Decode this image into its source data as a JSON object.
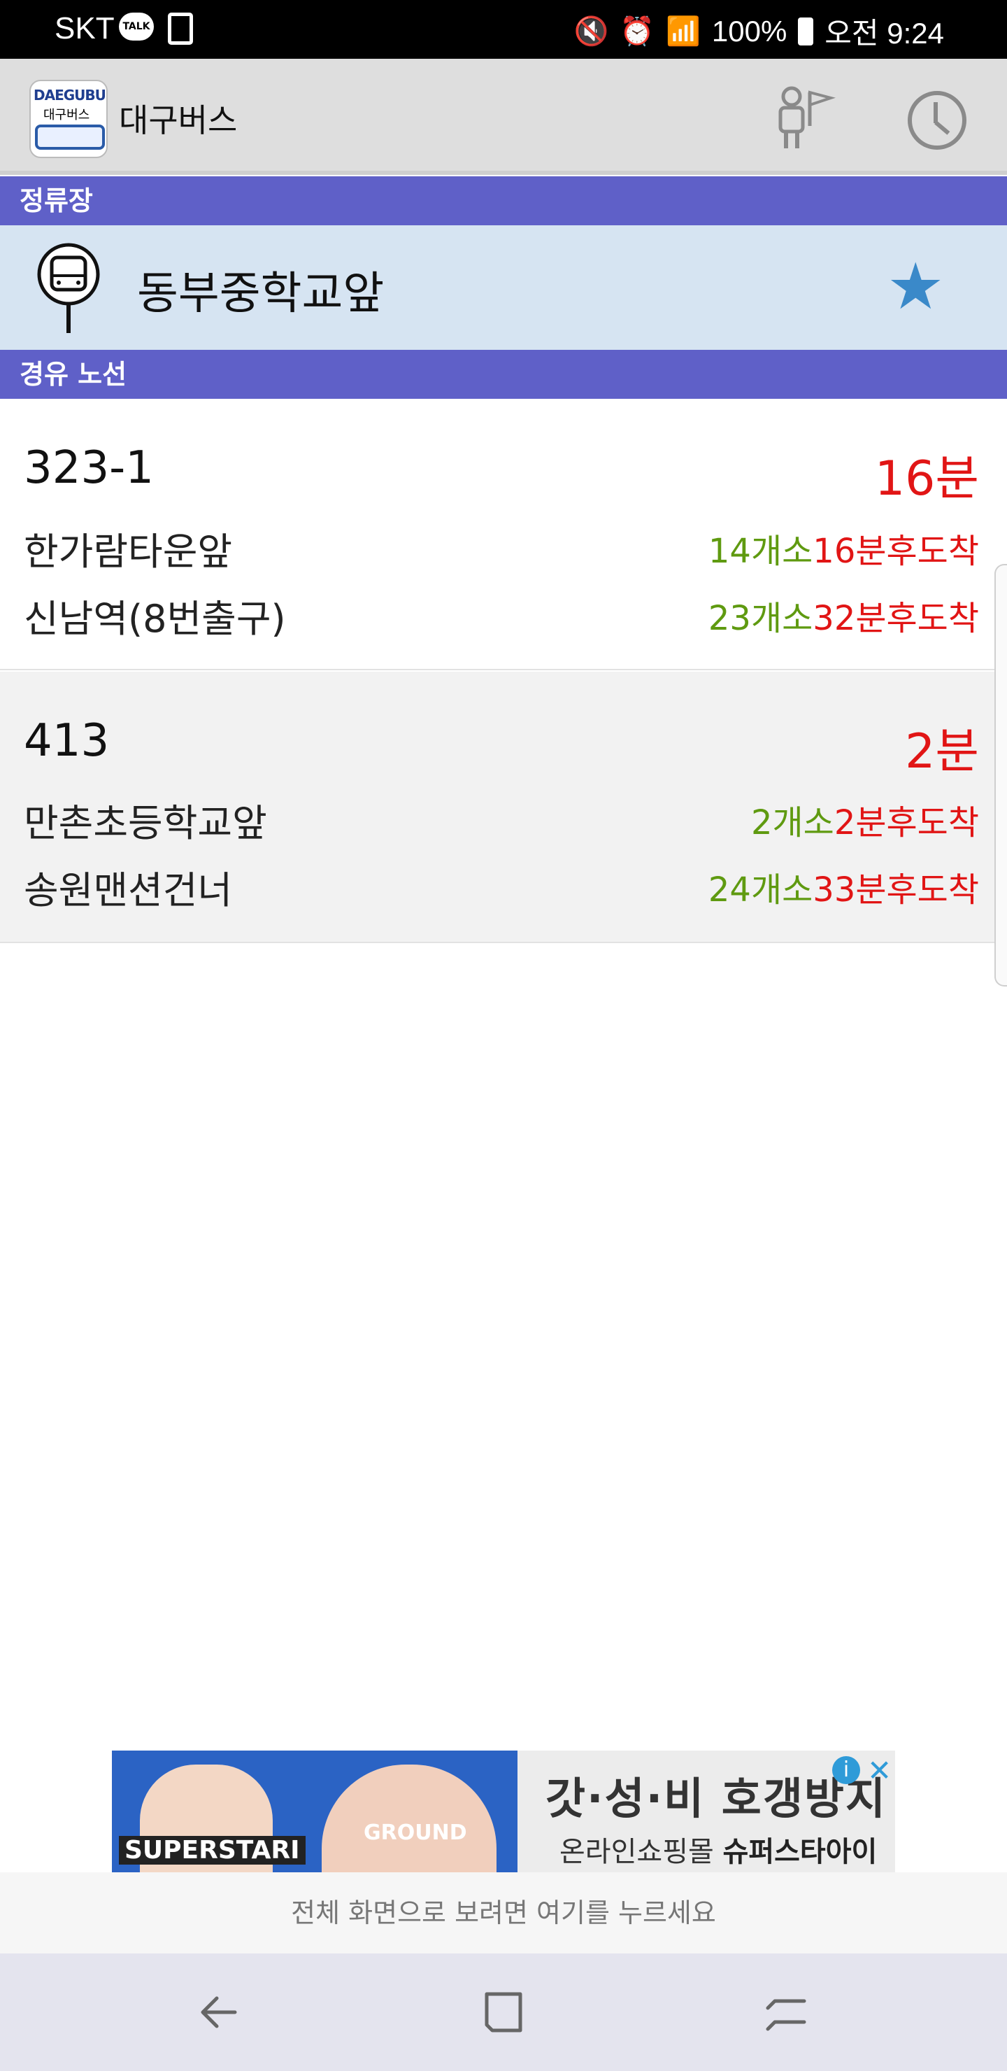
{
  "status_bar": {
    "carrier": "SKT",
    "talk_badge": "TALK",
    "battery": "100%",
    "time": "오전 9:24"
  },
  "app_bar": {
    "logo_text_en": "DAEGUBUS",
    "logo_text_ko": "대구버스",
    "title": "대구버스"
  },
  "stop_section": {
    "header": "정류장",
    "stop_name": "동부중학교앞"
  },
  "routes_section": {
    "header": "경유 노선"
  },
  "routes": [
    {
      "number": "323-1",
      "eta": "16분",
      "stops": [
        {
          "name": "한가람타운앞",
          "count": "14개소",
          "arrival": "16분후도착"
        },
        {
          "name": "신남역(8번출구)",
          "count": "23개소",
          "arrival": "32분후도착"
        }
      ]
    },
    {
      "number": "413",
      "eta": "2분",
      "stops": [
        {
          "name": "만촌초등학교앞",
          "count": "2개소",
          "arrival": "2분후도착"
        },
        {
          "name": "송원맨션건너",
          "count": "24개소",
          "arrival": "33분후도착"
        }
      ]
    }
  ],
  "ad": {
    "brand_left": "SUPERSTARI",
    "shirt_text": "GROUND",
    "headline": "갓·성·비 호갱방지",
    "sub_prefix": "온라인쇼핑몰 ",
    "sub_brand": "슈퍼스타아이"
  },
  "fullscreen_hint": "전체 화면으로 보려면 여기를 누르세요",
  "colors": {
    "section_header": "#5f60c8",
    "stop_row": "#d6e4f2",
    "eta_red": "#e11515",
    "count_green": "#5f9a10",
    "star_blue": "#3a89c9"
  }
}
